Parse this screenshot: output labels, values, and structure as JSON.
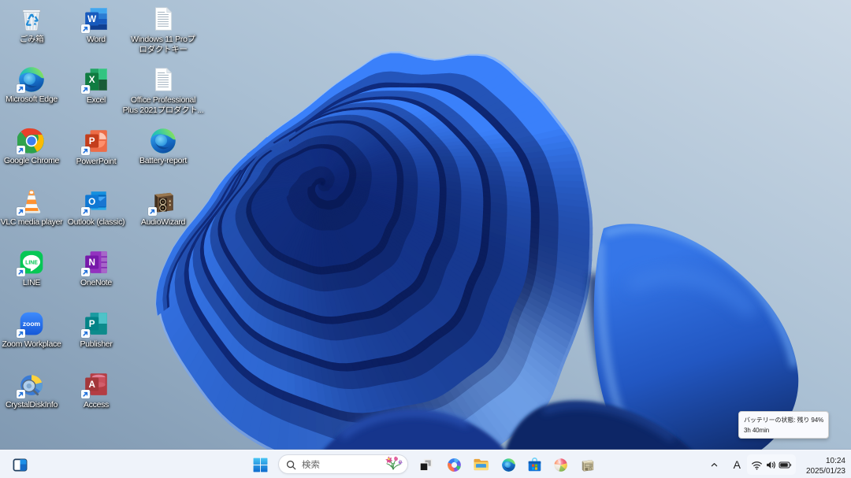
{
  "desktop": {
    "icons": [
      {
        "label": "ごみ箱",
        "icon": "recycle-bin",
        "col": 0,
        "row": 0,
        "shortcut": false
      },
      {
        "label": "Microsoft Edge",
        "icon": "edge",
        "col": 0,
        "row": 1,
        "shortcut": true
      },
      {
        "label": "Google Chrome",
        "icon": "chrome",
        "col": 0,
        "row": 2,
        "shortcut": true
      },
      {
        "label": "VLC media player",
        "icon": "vlc",
        "col": 0,
        "row": 3,
        "shortcut": true
      },
      {
        "label": "LINE",
        "icon": "line",
        "col": 0,
        "row": 4,
        "shortcut": true
      },
      {
        "label": "Zoom Workplace",
        "icon": "zoom",
        "col": 0,
        "row": 5,
        "shortcut": true
      },
      {
        "label": "CrystalDiskInfo",
        "icon": "crystaldiskinfo",
        "col": 0,
        "row": 6,
        "shortcut": true
      },
      {
        "label": "Word",
        "icon": "word",
        "col": 1,
        "row": 0,
        "shortcut": true
      },
      {
        "label": "Excel",
        "icon": "excel",
        "col": 1,
        "row": 1,
        "shortcut": true
      },
      {
        "label": "PowerPoint",
        "icon": "powerpoint",
        "col": 1,
        "row": 2,
        "shortcut": true
      },
      {
        "label": "Outlook (classic)",
        "icon": "outlook",
        "col": 1,
        "row": 3,
        "shortcut": true
      },
      {
        "label": "OneNote",
        "icon": "onenote",
        "col": 1,
        "row": 4,
        "shortcut": true
      },
      {
        "label": "Publisher",
        "icon": "publisher",
        "col": 1,
        "row": 5,
        "shortcut": true
      },
      {
        "label": "Access",
        "icon": "access",
        "col": 1,
        "row": 6,
        "shortcut": true
      },
      {
        "label": "Windows 11 Proプ\nロダクトキー",
        "icon": "text-file",
        "col": 2,
        "row": 0,
        "shortcut": false
      },
      {
        "label": "Office Professional\nPlus 2021プロダクト...",
        "icon": "text-file",
        "col": 2,
        "row": 1,
        "shortcut": false
      },
      {
        "label": "Battery-report",
        "icon": "edge",
        "col": 2,
        "row": 2,
        "shortcut": false
      },
      {
        "label": "AudioWizard",
        "icon": "audiowizard",
        "col": 2,
        "row": 3,
        "shortcut": true
      }
    ]
  },
  "taskbar": {
    "corner_button": {
      "icon": "screen-split"
    },
    "start": {
      "icon": "windows-start"
    },
    "search": {
      "placeholder": "検索",
      "icon": "search",
      "decoration": "spring-flowers"
    },
    "buttons": [
      {
        "name": "task-view",
        "icon": "task-view"
      },
      {
        "name": "copilot",
        "icon": "copilot"
      },
      {
        "name": "file-explorer",
        "icon": "file-explorer"
      },
      {
        "name": "edge",
        "icon": "edge"
      },
      {
        "name": "microsoft-store",
        "icon": "microsoft-store"
      },
      {
        "name": "color-sphere-app",
        "icon": "color-sphere"
      },
      {
        "name": "beige-device-app",
        "icon": "beige-device"
      }
    ],
    "tray": {
      "chevron": "^",
      "ime": "A",
      "icons": [
        {
          "name": "wifi"
        },
        {
          "name": "volume"
        },
        {
          "name": "battery"
        }
      ]
    },
    "clock": {
      "time": "10:24",
      "date": "2025/01/23"
    }
  },
  "tooltip": {
    "line1": "バッテリーの状態: 残り 94%",
    "line2": "3h 40min"
  },
  "colors": {
    "taskbar_bg": "#eff3fa",
    "wallpaper_bloom_bright": "#347af8",
    "wallpaper_bloom_dark": "#0a1e56",
    "wallpaper_sky_top_right": "#ccd9e6",
    "wallpaper_sky_bottom_left": "#7e97b0",
    "tooltip_bg": "#f9fafe",
    "start_logo_blue": "#0a66cc"
  }
}
